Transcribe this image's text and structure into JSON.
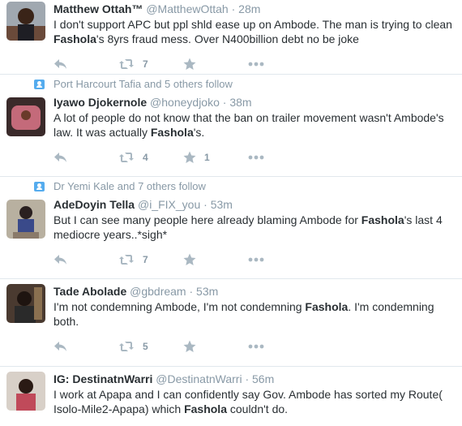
{
  "tweets": [
    {
      "context": "",
      "fullname": "Matthew Ottah™",
      "username": "@MatthewOttah",
      "time": "28m",
      "parts": [
        {
          "t": "I don't support APC but ppl shld ease up on Ambode. The man is trying to clean "
        },
        {
          "t": "Fashola",
          "b": true
        },
        {
          "t": "'s 8yrs fraud mess. Over N400billion debt no be joke"
        }
      ],
      "retweets": "7",
      "favorites": ""
    },
    {
      "context": "Port Harcourt Tafia and 5 others follow",
      "fullname": "Iyawo Djokernole",
      "username": "@honeydjoko",
      "time": "38m",
      "parts": [
        {
          "t": "A lot of people do not know that the ban on trailer movement wasn't Ambode's law. It was actually "
        },
        {
          "t": "Fashola",
          "b": true
        },
        {
          "t": "'s."
        }
      ],
      "retweets": "4",
      "favorites": "1"
    },
    {
      "context": "Dr Yemi Kale and 7 others follow",
      "fullname": "AdeDoyin Tella",
      "username": "@i_FIX_you",
      "time": "53m",
      "parts": [
        {
          "t": "But I can see many people here already blaming Ambode for "
        },
        {
          "t": "Fashola",
          "b": true
        },
        {
          "t": "'s last 4 mediocre years..*sigh*"
        }
      ],
      "retweets": "7",
      "favorites": ""
    },
    {
      "context": "",
      "fullname": "Tade Abolade",
      "username": "@gbdream",
      "time": "53m",
      "parts": [
        {
          "t": "I'm not condemning Ambode, I'm not condemning "
        },
        {
          "t": "Fashola",
          "b": true
        },
        {
          "t": ". I'm condemning both."
        }
      ],
      "retweets": "5",
      "favorites": ""
    },
    {
      "context": "",
      "fullname": "IG: DestinatnWarri",
      "username": "@DestinatnWarri",
      "time": "56m",
      "parts": [
        {
          "t": "I work at Apapa and I can confidently say Gov. Ambode has sorted my Route( Isolo-Mile2-Apapa) which "
        },
        {
          "t": "Fashola",
          "b": true
        },
        {
          "t": " couldn't do."
        }
      ],
      "retweets": "",
      "favorites": ""
    }
  ],
  "colors": {
    "avatar_bg": [
      "#6a4a3a",
      "#3a2a2a",
      "#8a7a6a",
      "#4a3a30",
      "#5a4a3a"
    ]
  },
  "separator": "·"
}
